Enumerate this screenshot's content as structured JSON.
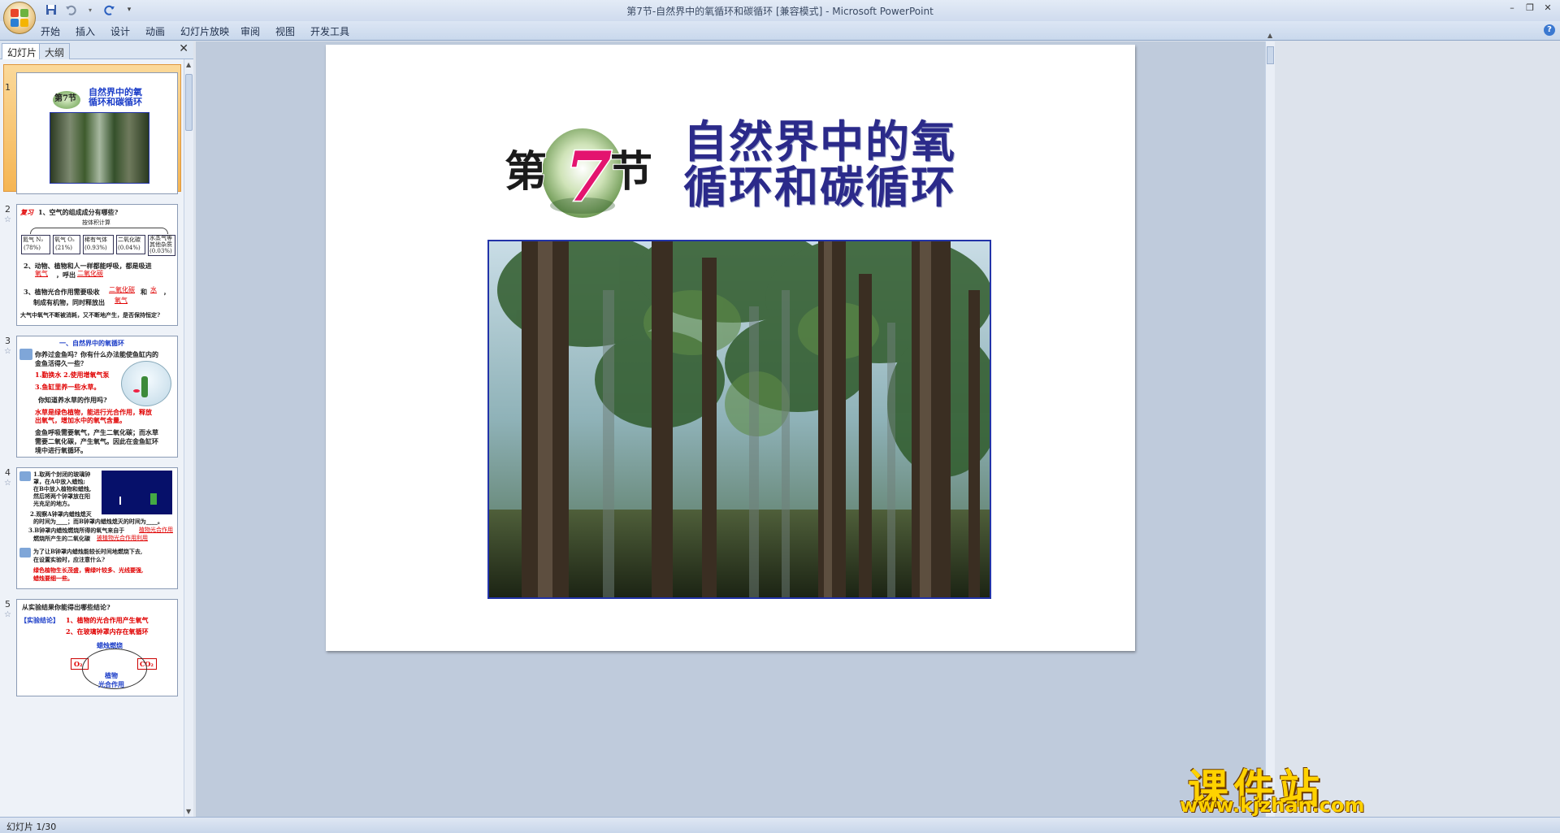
{
  "window": {
    "title": "第7节-自然界中的氧循环和碳循环 [兼容模式] - Microsoft PowerPoint"
  },
  "ribbon": {
    "tabs": [
      "开始",
      "插入",
      "设计",
      "动画",
      "幻灯片放映",
      "审阅",
      "视图",
      "开发工具"
    ]
  },
  "panel": {
    "tab_slides": "幻灯片",
    "tab_outline": "大纲",
    "close": "✕"
  },
  "thumbs": {
    "n1": "1",
    "n2": "2",
    "n3": "3",
    "n4": "4",
    "n5": "5",
    "t1": {
      "title_l1": "自然界中的氧",
      "title_l2": "循环和碳循环",
      "badge": "第7节"
    },
    "t2": {
      "review": "复习",
      "q1": "1、空气的组成成分有哪些?",
      "by_volume": "按体积计算",
      "c1": "氮气 N₂",
      "c1v": "(78%)",
      "c2": "氧气 O₂",
      "c2v": "(21%)",
      "c3": "稀有气体",
      "c3v": "(0.93%)",
      "c4": "二氧化碳",
      "c4v": "(0.04%)",
      "c5": "水蒸气等",
      "c5b": "其他杂质",
      "c5v": "(0.03%)",
      "q2": "2、动物、植物和人一样都能呼吸，都是吸进",
      "q2b": "，呼出",
      "a2a": "氧气",
      "a2b": "二氧化碳",
      "q3": "3、植物光合作用需要吸收",
      "q3b": "和",
      "q3c": "，",
      "a3a": "二氧化碳",
      "a3b": "水",
      "q3d": "制成有机物，同时释放出",
      "a3c": "氧气",
      "q4": "大气中氧气不断被消耗，又不断地产生，是否保持恒定?"
    },
    "t3": {
      "head": "一、自然界中的氧循环",
      "q": "你养过金鱼吗？你有什么办法能使鱼缸内的",
      "q2": "金鱼活得久一些？",
      "a1": "1.勤换水  2.使用增氧气泵",
      "a2": "3.鱼缸里养一些水草。",
      "q3": "你知道养水草的作用吗?",
      "a3": "水草是绿色植物，能进行光合作用，释放",
      "a4": "出氧气，增加水中的氧气含量。",
      "p1": "金鱼呼吸需要氧气，产生二氧化碳；而水草",
      "p2": "需要二氧化碳，产生氧气。因此在金鱼缸环",
      "p3": "境中进行氧循环。"
    },
    "t4": {
      "l1": "1.取两个封闭的玻璃钟",
      "l2": "罩，在A中放入蜡烛;",
      "l3": "在B中放入植物和蜡烛,",
      "l4": "然后将两个钟罩放在阳",
      "l5": "光充足的地方。",
      "l6": "2.观察A钟罩内蜡烛熄灭",
      "l7": "的时间为____；而B钟罩内蜡烛熄灭的时间为____。",
      "l8": "3.B钟罩内蜡烛燃烧所得的氧气来自于",
      "l8a": "植物光合作用",
      "l9": "燃烧所产生的二氧化碳",
      "l9a": "被植物光合作用利用",
      "l10": "为了让B钟罩内蜡烛能较长时间地燃烧下去,",
      "l11": "在设置实验时，应注意什么?",
      "l12": "绿色植物生长茂盛，需绿叶较多、光线要强,",
      "l13": "蜡烛要细一些。"
    },
    "t5": {
      "q": "从实验结果你能得出哪些结论?",
      "c_label": "【实验结论】",
      "c1": "1、植物的光合作用产生氧气",
      "c2": "2、在玻璃钟罩内存在氧循环",
      "burn": "蜡烛燃烧",
      "o2": "O₂",
      "co2": "CO₂",
      "plant": "植物",
      "photo": "光合作用"
    }
  },
  "slide": {
    "badge_char1": "第",
    "badge_num": "7",
    "badge_char2": "节",
    "title_l1": "自然界中的氧",
    "title_l2": "循环和碳循环"
  },
  "status": {
    "text": "幻灯片 1/30"
  },
  "watermark": {
    "cn": "课件站",
    "url": "www.kjzhan.com"
  },
  "colors": {
    "title_blue": "#2b2a8a",
    "accent_red": "#e00000",
    "selection_orange": "#f5b553",
    "watermark_yellow": "#ffd200"
  }
}
